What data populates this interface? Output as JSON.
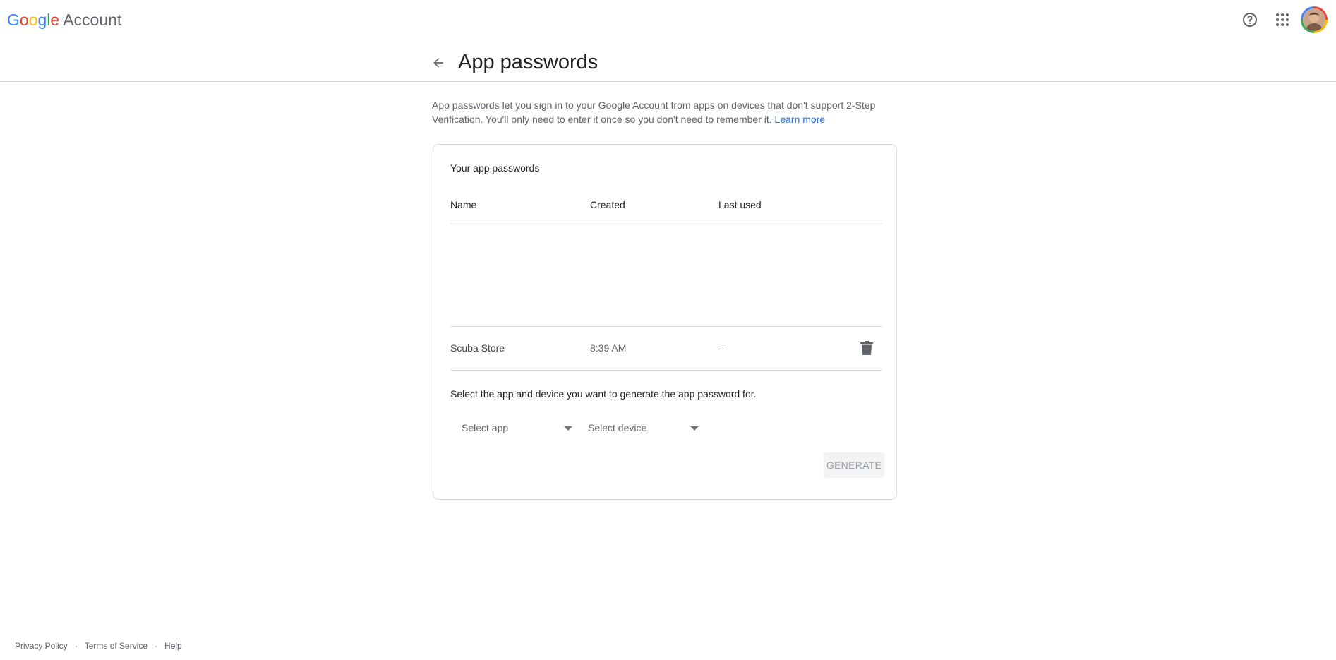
{
  "header": {
    "logo_letters": [
      "G",
      "o",
      "o",
      "g",
      "l",
      "e"
    ],
    "logo_colors": [
      "#4285f4",
      "#ea4335",
      "#fbbc05",
      "#4285f4",
      "#34a853",
      "#ea4335"
    ],
    "logo_suffix": "Account",
    "icons": [
      "help-icon",
      "apps-grid-icon",
      "avatar"
    ]
  },
  "page": {
    "title": "App passwords",
    "intro_text": "App passwords let you sign in to your Google Account from apps on devices that don't support 2-Step Verification. You'll only need to enter it once so you don't need to remember it.",
    "learn_more": "Learn more",
    "link_color": "#1a73e8"
  },
  "card": {
    "title": "Your app passwords",
    "columns": [
      "Name",
      "Created",
      "Last used"
    ],
    "rows": [
      {
        "name": "Scuba Store",
        "created": "8:39 AM",
        "last_used": "–"
      }
    ],
    "generate_label": "Select the app and device you want to generate the app password for.",
    "select_app_placeholder": "Select app",
    "select_device_placeholder": "Select device",
    "generate_button": "GENERATE"
  },
  "footer": {
    "links": [
      "Privacy Policy",
      "Terms of Service",
      "Help"
    ],
    "separator": "·"
  }
}
